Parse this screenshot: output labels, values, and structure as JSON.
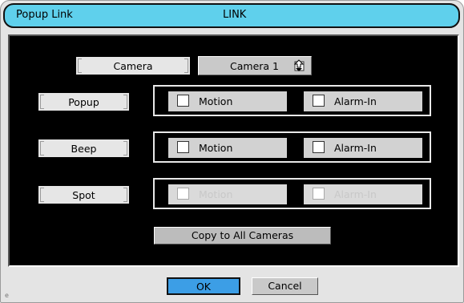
{
  "window": {
    "title": "Popup Link",
    "subtitle": "LINK"
  },
  "camera": {
    "label": "Camera",
    "selected": "Camera 1",
    "dropdown_icon": "dropdown-arrow-icon"
  },
  "rows": [
    {
      "label": "Popup",
      "motion": {
        "label": "Motion",
        "checked": false,
        "enabled": true
      },
      "alarm": {
        "label": "Alarm-In",
        "checked": false,
        "enabled": true
      }
    },
    {
      "label": "Beep",
      "motion": {
        "label": "Motion",
        "checked": false,
        "enabled": true
      },
      "alarm": {
        "label": "Alarm-In",
        "checked": false,
        "enabled": true
      }
    },
    {
      "label": "Spot",
      "motion": {
        "label": "Motion",
        "checked": false,
        "enabled": false
      },
      "alarm": {
        "label": "Alarm-In",
        "checked": false,
        "enabled": false
      }
    }
  ],
  "copy_label": "Copy to All Cameras",
  "buttons": {
    "ok": "OK",
    "cancel": "Cancel"
  },
  "corner_mark": "e",
  "colors": {
    "titlebar": "#5fd0ec",
    "panel": "#000000",
    "ok_button": "#3c9ee6",
    "window": "#e4e4e4"
  }
}
